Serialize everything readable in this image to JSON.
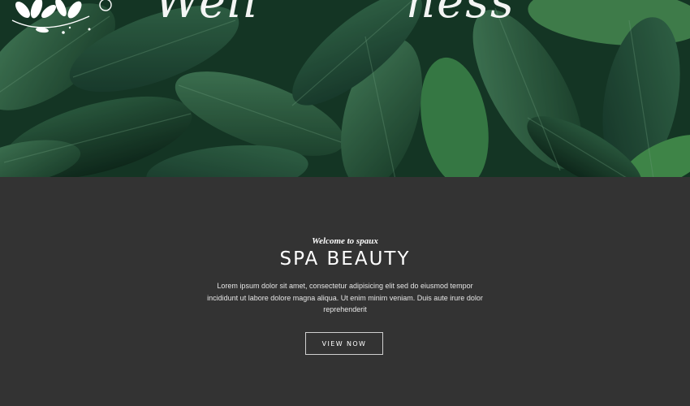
{
  "hero": {
    "logo_left": "Well",
    "logo_right": "ness"
  },
  "intro": {
    "tagline": "Welcome to spaux",
    "title": "SPA BEAUTY",
    "description": "Lorem ipsum dolor sit amet, consectetur adipisicing elit sed do eiusmod tempor incididunt ut labore dolore magna aliqua. Ut enim minim veniam. Duis aute irure dolor reprehenderit",
    "button_label": "VIEW NOW"
  }
}
